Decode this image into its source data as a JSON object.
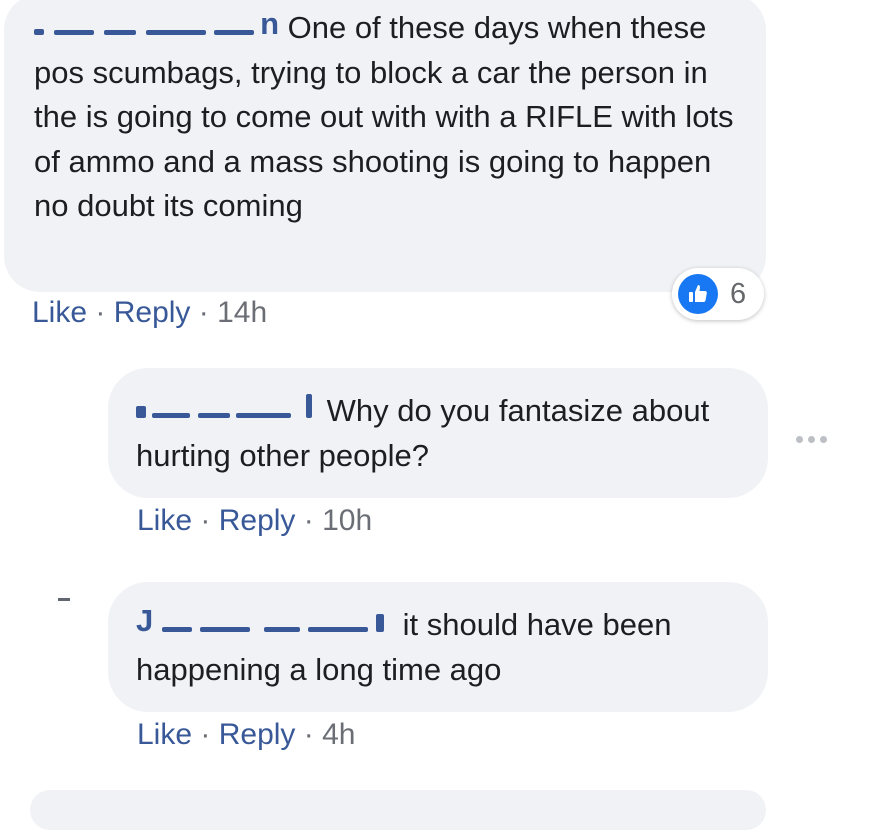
{
  "comments": [
    {
      "author_visible_suffix": "n",
      "text": " One of these days when these pos scumbags, trying to block a car the person in the is going to come out with with a RIFLE with lots of ammo and a mass shooting is going to happen no doubt its coming",
      "actions": {
        "like": "Like",
        "reply": "Reply",
        "time": "14h",
        "sep": " · "
      },
      "reactions": {
        "icon": "thumbs-up-icon",
        "count": "6"
      }
    },
    {
      "author_visible_suffix": "",
      "text": " Why do you fantasize about hurting other people?",
      "actions": {
        "like": "Like",
        "reply": "Reply",
        "time": "10h",
        "sep": " · "
      }
    },
    {
      "author_visible_prefix": "J",
      "text": " it should have been happening a long time ago",
      "actions": {
        "like": "Like",
        "reply": "Reply",
        "time": "4h",
        "sep": " · "
      }
    }
  ],
  "more_options": {
    "icon": "more-horizontal-icon"
  },
  "colors": {
    "bubble": "#f0f2f5",
    "link": "#385898",
    "meta": "#6b6f75",
    "like_blue": "#1877f2"
  }
}
